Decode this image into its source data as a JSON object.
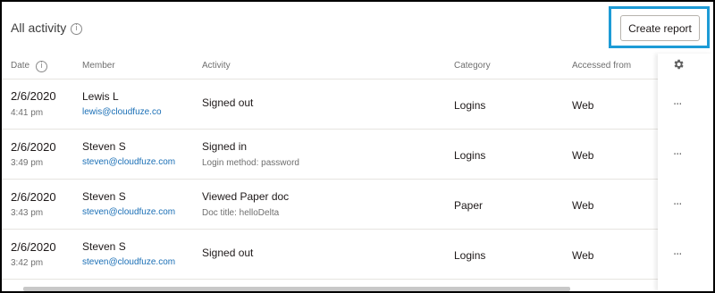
{
  "header": {
    "title": "All activity",
    "info_glyph": "i",
    "create_report_label": "Create report"
  },
  "columns": {
    "date": "Date",
    "member": "Member",
    "activity": "Activity",
    "category": "Category",
    "accessed_from": "Accessed from",
    "settings_icon": "gear-icon"
  },
  "rows": [
    {
      "date": "2/6/2020",
      "time": "4:41 pm",
      "member": "Lewis L",
      "email": "lewis@cloudfuze.co",
      "activity": "Signed out",
      "detail": "",
      "category": "Logins",
      "accessed_from": "Web",
      "menu": "···"
    },
    {
      "date": "2/6/2020",
      "time": "3:49 pm",
      "member": "Steven S",
      "email": "steven@cloudfuze.com",
      "activity": "Signed in",
      "detail": "Login method: password",
      "category": "Logins",
      "accessed_from": "Web",
      "menu": "···"
    },
    {
      "date": "2/6/2020",
      "time": "3:43 pm",
      "member": "Steven S",
      "email": "steven@cloudfuze.com",
      "activity": "Viewed Paper doc",
      "detail": "Doc title: helloDelta",
      "category": "Paper",
      "accessed_from": "Web",
      "menu": "···"
    },
    {
      "date": "2/6/2020",
      "time": "3:42 pm",
      "member": "Steven S",
      "email": "steven@cloudfuze.com",
      "activity": "Signed out",
      "detail": "",
      "category": "Logins",
      "accessed_from": "Web",
      "menu": "···"
    }
  ],
  "colors": {
    "highlight": "#1d9bd6",
    "link": "#1a6fb6",
    "divider": "#e6e4e0"
  }
}
